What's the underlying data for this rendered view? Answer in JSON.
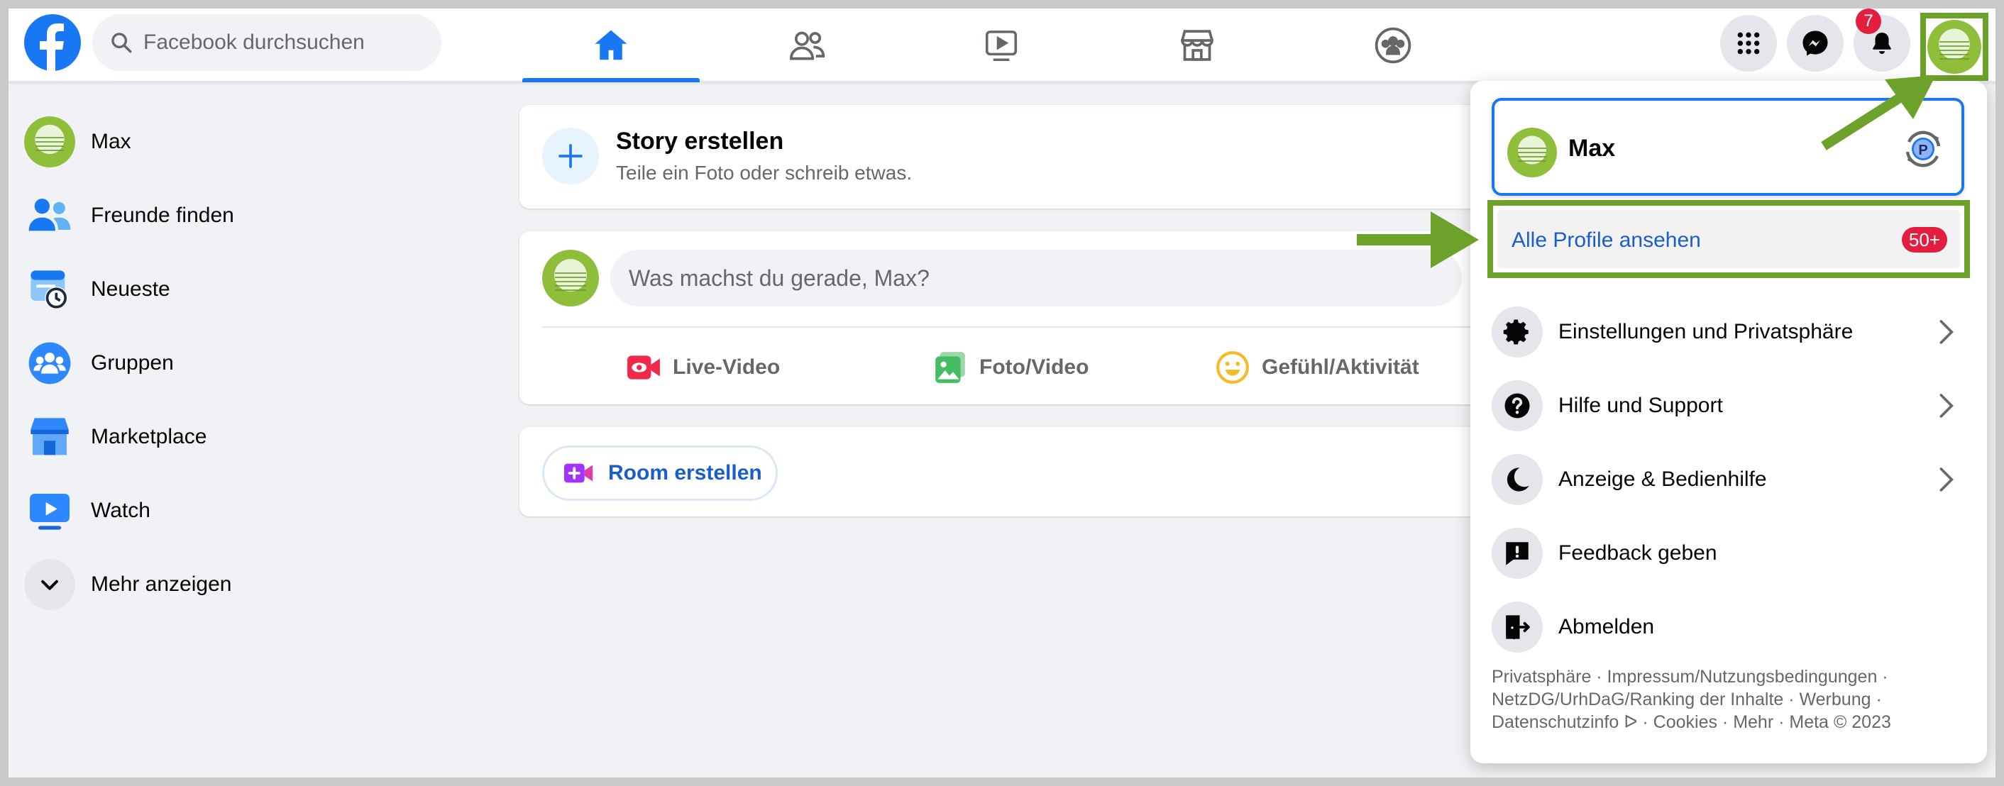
{
  "search": {
    "placeholder": "Facebook durchsuchen"
  },
  "nav": {
    "tabs": [
      {
        "icon": "home-icon",
        "active": true
      },
      {
        "icon": "friends-icon",
        "active": false
      },
      {
        "icon": "watch-icon",
        "active": false
      },
      {
        "icon": "marketplace-icon",
        "active": false
      },
      {
        "icon": "groups-icon",
        "active": false
      }
    ]
  },
  "header": {
    "notifications_badge": "7"
  },
  "sidebar": {
    "items": [
      {
        "label": "Max",
        "icon": "avatar"
      },
      {
        "label": "Freunde finden",
        "icon": "friends-icon"
      },
      {
        "label": "Neueste",
        "icon": "clock-feed-icon"
      },
      {
        "label": "Gruppen",
        "icon": "groups-icon"
      },
      {
        "label": "Marketplace",
        "icon": "shop-icon"
      },
      {
        "label": "Watch",
        "icon": "video-icon"
      },
      {
        "label": "Mehr anzeigen",
        "icon": "chevron-down-icon"
      }
    ]
  },
  "story": {
    "title": "Story erstellen",
    "subtitle": "Teile ein Foto oder schreib etwas."
  },
  "composer": {
    "placeholder": "Was machst du gerade, Max?",
    "actions": [
      {
        "label": "Live-Video",
        "color": "#f02849"
      },
      {
        "label": "Foto/Video",
        "color": "#45bd62"
      },
      {
        "label": "Gefühl/Aktivität",
        "color": "#f7b928"
      }
    ]
  },
  "room": {
    "label": "Room erstellen"
  },
  "dropdown": {
    "profile_name": "Max",
    "all_profiles_label": "Alle Profile ansehen",
    "all_profiles_count": "50+",
    "menu": [
      {
        "label": "Einstellungen und Privatsphäre",
        "icon": "gear-icon",
        "chevron": true
      },
      {
        "label": "Hilfe und Support",
        "icon": "help-icon",
        "chevron": true
      },
      {
        "label": "Anzeige & Bedienhilfe",
        "icon": "moon-icon",
        "chevron": true
      },
      {
        "label": "Feedback geben",
        "icon": "feedback-icon",
        "chevron": false
      },
      {
        "label": "Abmelden",
        "icon": "logout-icon",
        "chevron": false
      }
    ],
    "footer_line1": "Privatsphäre · Impressum/Nutzungsbedingungen ·",
    "footer_line2": "NetzDG/UrhDaG/Ranking der Inhalte · Werbung ·",
    "footer_line3": "Datenschutzinfo ᐅ · Cookies · Mehr · Meta © 2023"
  },
  "colors": {
    "accent": "#1877f2",
    "highlight": "#6da22a",
    "badge": "#e41e3f"
  }
}
